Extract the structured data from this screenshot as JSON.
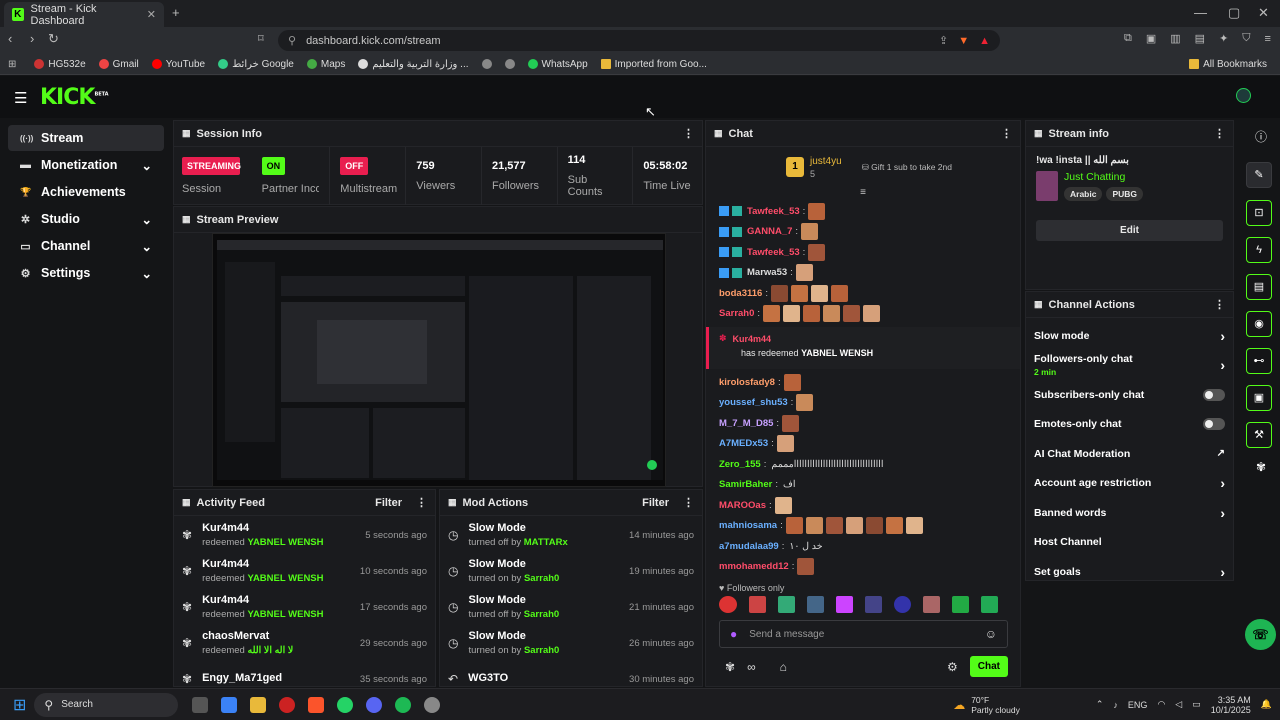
{
  "browser": {
    "tab_title": "Stream - Kick Dashboard",
    "url": "dashboard.kick.com/stream",
    "bookmarks": [
      "HG532e",
      "Gmail",
      "YouTube",
      "خرائط Google",
      "Maps",
      "وزارة التربية والتعليم ...",
      "WhatsApp",
      "Imported from Goo..."
    ],
    "all_bookmarks": "All Bookmarks"
  },
  "app": {
    "logo": "KICK",
    "beta": "BETA"
  },
  "nav": {
    "items": [
      {
        "label": "Stream",
        "icon": "((·))"
      },
      {
        "label": "Monetization",
        "icon": "▬"
      },
      {
        "label": "Achievements",
        "icon": "🏆"
      },
      {
        "label": "Studio",
        "icon": "✲"
      },
      {
        "label": "Channel",
        "icon": "▭"
      },
      {
        "label": "Settings",
        "icon": "⚙"
      }
    ]
  },
  "session": {
    "title": "Session Info",
    "streaming_badge": "STREAMING",
    "streaming_label": "Session",
    "partner_badge": "ON",
    "partner_label": "Partner Income",
    "multistream_badge": "OFF",
    "multistream_label": "Multistream",
    "viewers": "759",
    "viewers_label": "Viewers",
    "followers": "21,577",
    "followers_label": "Followers",
    "subs": "114",
    "subs_label": "Sub Counts",
    "time": "05:58:02",
    "time_label": "Time Live"
  },
  "preview": {
    "title": "Stream Preview"
  },
  "activity": {
    "title": "Activity Feed",
    "filter": "Filter",
    "rows": [
      {
        "name": "Kur4m44",
        "sub": "redeemed",
        "item": "YABNEL WENSH",
        "time": "5 seconds ago"
      },
      {
        "name": "Kur4m44",
        "sub": "redeemed",
        "item": "YABNEL WENSH",
        "time": "10 seconds ago"
      },
      {
        "name": "Kur4m44",
        "sub": "redeemed",
        "item": "YABNEL WENSH",
        "time": "17 seconds ago"
      },
      {
        "name": "chaosMervat",
        "sub": "redeemed",
        "item": "لا اله الا الله",
        "time": "29 seconds ago"
      },
      {
        "name": "Engy_Ma71ged",
        "sub": "",
        "item": "",
        "time": "35 seconds ago"
      }
    ]
  },
  "mod": {
    "title": "Mod Actions",
    "filter": "Filter",
    "rows": [
      {
        "name": "Slow Mode",
        "sub": "turned off by",
        "item": "MATTARx",
        "time": "14 minutes ago"
      },
      {
        "name": "Slow Mode",
        "sub": "turned on by",
        "item": "Sarrah0",
        "time": "19 minutes ago"
      },
      {
        "name": "Slow Mode",
        "sub": "turned off by",
        "item": "Sarrah0",
        "time": "21 minutes ago"
      },
      {
        "name": "Slow Mode",
        "sub": "turned on by",
        "item": "Sarrah0",
        "time": "26 minutes ago"
      },
      {
        "name": "WG3TO",
        "sub": "",
        "item": "",
        "time": "30 minutes ago"
      }
    ]
  },
  "chat": {
    "title": "Chat",
    "pinned_user": "just4yu",
    "pinned_count": "5",
    "gift_text": "Gift 1 sub to take 2nd",
    "messages": [
      {
        "user": "Tawfeek_53",
        "color": "#ff4d6a",
        "text": "",
        "emotes": 1
      },
      {
        "user": "GANNA_7",
        "color": "#ff4d6a",
        "text": "",
        "emotes": 1
      },
      {
        "user": "Tawfeek_53",
        "color": "#ff4d6a",
        "text": "",
        "emotes": 1
      },
      {
        "user": "Marwa53",
        "color": "#dddddd",
        "text": "",
        "emotes": 1
      },
      {
        "user": "boda3116",
        "color": "#ff9e6b",
        "text": "",
        "emotes": 4
      },
      {
        "user": "Sarrah0",
        "color": "#ff4d6a",
        "text": "",
        "emotes": 6
      }
    ],
    "redeem_user": "Kur4m44",
    "redeem_text": "has redeemed",
    "redeem_item": "YABNEL WENSH",
    "messages2": [
      {
        "user": "kirolosfady8",
        "color": "#ff9e6b",
        "text": "",
        "emotes": 1
      },
      {
        "user": "youssef_shu53",
        "color": "#6ab0ff",
        "text": "",
        "emotes": 1
      },
      {
        "user": "M_7_M_D85",
        "color": "#c7a0ff",
        "text": "",
        "emotes": 1
      },
      {
        "user": "A7MEDx53",
        "color": "#6ab0ff",
        "text": "",
        "emotes": 1
      },
      {
        "user": "Zero_155",
        "color": "#53fc18",
        "text": "اااااااااااااااااااااااااااااااااامممم",
        "emotes": 0
      },
      {
        "user": "SamirBaher",
        "color": "#53fc18",
        "text": "اف",
        "emotes": 0
      },
      {
        "user": "MAROOas",
        "color": "#ff4d6a",
        "text": "",
        "emotes": 1
      },
      {
        "user": "mahniosama",
        "color": "#6ab0ff",
        "text": "",
        "emotes": 7
      },
      {
        "user": "a7mudalaa99",
        "color": "#6ab0ff",
        "text": "خد ل ١٠",
        "emotes": 0
      },
      {
        "user": "mmohamedd12",
        "color": "#ff4d6a",
        "text": "",
        "emotes": 1
      }
    ],
    "followers_only": "Followers only",
    "input_placeholder": "Send a message",
    "send_label": "Chat"
  },
  "stream_info": {
    "title": "Stream info",
    "stream_title": "!wa !insta || بسم الله",
    "category": "Just Chatting",
    "tags": [
      "Arabic",
      "PUBG"
    ],
    "edit": "Edit"
  },
  "actions": {
    "title": "Channel Actions",
    "rows": [
      {
        "label": "Slow mode",
        "sub": "",
        "control": "chevron"
      },
      {
        "label": "Followers-only chat",
        "sub": "2 min",
        "control": "chevron"
      },
      {
        "label": "Subscribers-only chat",
        "sub": "",
        "control": "toggle"
      },
      {
        "label": "Emotes-only chat",
        "sub": "",
        "control": "toggle"
      },
      {
        "label": "AI Chat Moderation",
        "sub": "",
        "control": "external"
      },
      {
        "label": "Account age restriction",
        "sub": "",
        "control": "chevron"
      },
      {
        "label": "Banned words",
        "sub": "",
        "control": "chevron"
      },
      {
        "label": "Host Channel",
        "sub": "",
        "control": "none"
      },
      {
        "label": "Set goals",
        "sub": "",
        "control": "chevron"
      }
    ]
  },
  "taskbar": {
    "search": "Search",
    "weather_temp": "70°F",
    "weather_desc": "Partly cloudy",
    "lang": "ENG",
    "time": "3:35 AM",
    "date": "10/1/2025"
  },
  "colors": {
    "accent": "#53fc18",
    "streaming": "#e91e4f"
  }
}
